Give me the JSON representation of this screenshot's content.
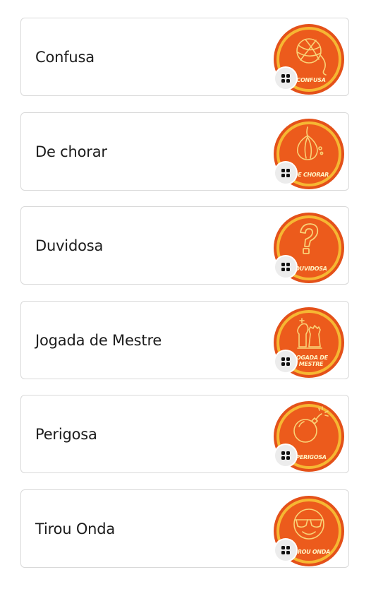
{
  "reactions": [
    {
      "label": "Confusa",
      "badge_text": "CONFUSA",
      "icon": "yarn-ball-icon"
    },
    {
      "label": "De chorar",
      "badge_text": "DE CHORAR",
      "icon": "onion-icon"
    },
    {
      "label": "Duvidosa",
      "badge_text": "DUVIDOSA",
      "icon": "question-mark-icon"
    },
    {
      "label": "Jogada de Mestre",
      "badge_text": "JOGADA DE MESTRE",
      "icon": "chess-pieces-icon"
    },
    {
      "label": "Perigosa",
      "badge_text": "PERIGOSA",
      "icon": "bomb-icon"
    },
    {
      "label": "Tirou Onda",
      "badge_text": "TIROU ONDA",
      "icon": "sunglasses-face-icon"
    }
  ],
  "badge_menu_icon": "grid-icon",
  "colors": {
    "badge_orange": "#ec5b1c",
    "badge_ring": "#f6b733",
    "badge_line": "#f9d277",
    "card_border": "#d9d9d9",
    "text": "#1c1c1c"
  }
}
